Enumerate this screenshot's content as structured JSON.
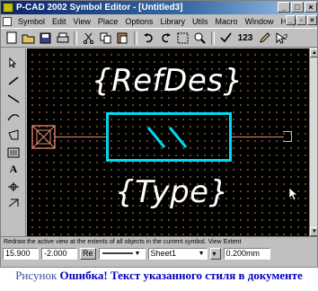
{
  "window": {
    "title": "P-CAD 2002 Symbol Editor - [Untitled3]"
  },
  "menu": [
    "Symbol",
    "Edit",
    "View",
    "Place",
    "Options",
    "Library",
    "Utils",
    "Macro",
    "Window",
    "Help"
  ],
  "toolbar": {
    "zoom_label": "123"
  },
  "canvas": {
    "refdes_text": "{RefDes}",
    "type_text": "{Type}",
    "colors": {
      "background": "#000000",
      "body_outline": "#00d8f0",
      "pin_lead": "#e88870",
      "text": "#ffffff",
      "grid": "#7a5a2a"
    }
  },
  "hint": "Redraw the active view at the extents of all objects in the current symbol. View Extent",
  "status": {
    "x": "15.900",
    "y": "-2.000",
    "re_button": "Re",
    "line_style": "",
    "sheet": "Sheet1",
    "width": "0.200mm"
  },
  "caption": {
    "prefix": "Рисунок",
    "message": "Ошибка! Текст указанного стиля в документе"
  }
}
